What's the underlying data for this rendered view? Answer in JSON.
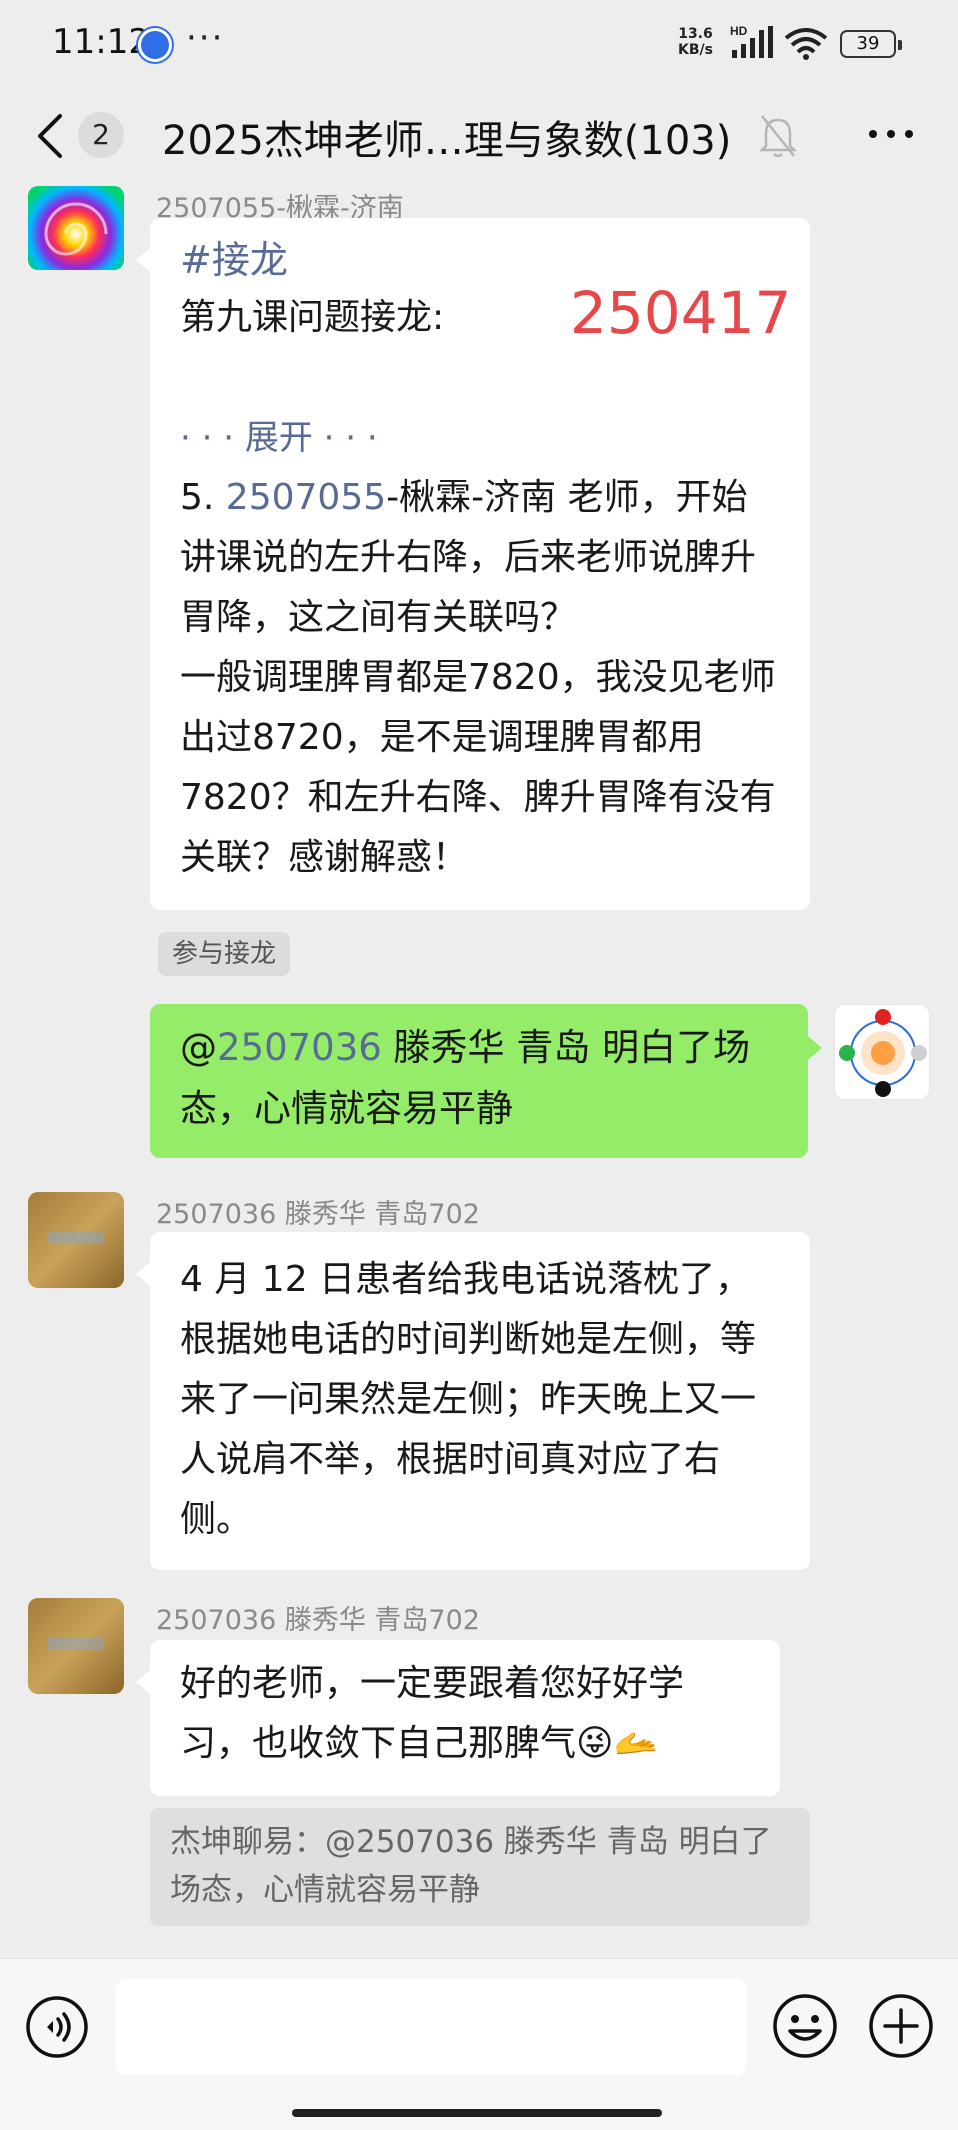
{
  "status_bar": {
    "time": "11:12",
    "dots": "···",
    "net_speed_value": "13.6",
    "net_speed_unit": "KB/s",
    "hd": "HD",
    "battery": "39"
  },
  "header": {
    "unread_count": "2",
    "title": "2025杰坤老师…理与象数(103)"
  },
  "messages": [
    {
      "sender": "2507055-楸霖-济南",
      "tag": "#接龙",
      "line1": "第九课问题接龙:",
      "number": "250417",
      "expand": "· · · 展开 · · ·",
      "q_prefix": "5. ",
      "q_id": "2507055",
      "q_rest": "-楸霖-济南 老师，开始讲课说的左升右降，后来老师说脾升胃降，这之间有关联吗？",
      "q_line2": "一般调理脾胃都是7820，我没见老师出过8720，是不是调理脾胃都用7820？和左升右降、脾升胃降有没有关联？感谢解惑！",
      "action": "参与接龙"
    },
    {
      "mention_at": "@",
      "mention_id": "2507036",
      "text": " 滕秀华  青岛  明白了场态，心情就容易平静"
    },
    {
      "sender": "2507036 滕秀华  青岛702",
      "text": "4 月 12 日患者给我电话说落枕了，根据她电话的时间判断她是左侧，等来了一问果然是左侧；昨天晚上又一人说肩不举，根据时间真对应了右侧。"
    },
    {
      "sender": "2507036 滕秀华  青岛702",
      "text": "好的老师，一定要跟着您好好学习，也收敛下自己那脾气😜🫴",
      "quote": "杰坤聊易：@2507036 滕秀华  青岛 明白了场态，心情就容易平静"
    }
  ],
  "input": {
    "placeholder": ""
  },
  "colors": {
    "bubble_self": "#95ec69",
    "link": "#576b95",
    "highlight_red": "#e8474a"
  },
  "icons": [
    "back-icon",
    "mute-icon",
    "more-icon",
    "voice-icon",
    "emoji-icon",
    "plus-icon"
  ]
}
